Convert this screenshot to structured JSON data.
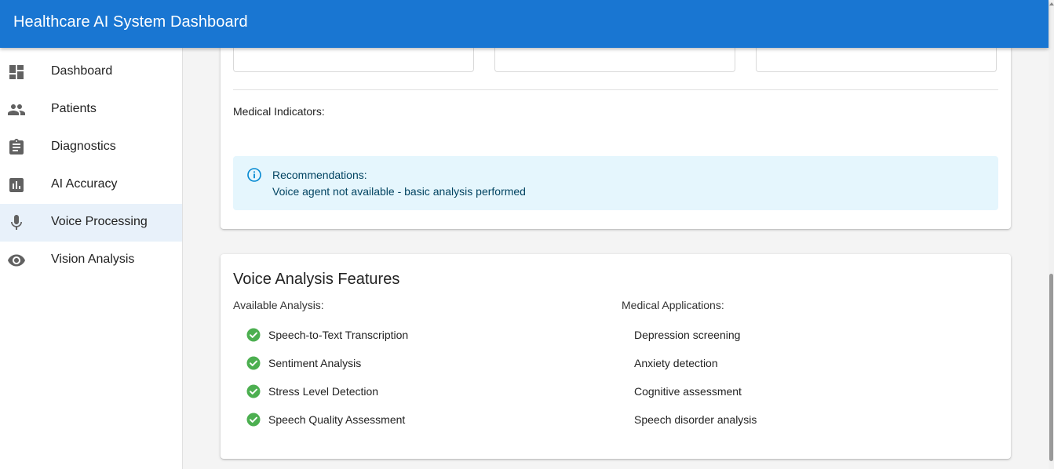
{
  "appbar": {
    "title": "Healthcare AI System Dashboard"
  },
  "sidebar": {
    "items": [
      {
        "label": "Dashboard",
        "icon": "dashboard-icon",
        "active": false
      },
      {
        "label": "Patients",
        "icon": "people-icon",
        "active": false
      },
      {
        "label": "Diagnostics",
        "icon": "clipboard-icon",
        "active": false
      },
      {
        "label": "AI Accuracy",
        "icon": "bar-chart-icon",
        "active": false
      },
      {
        "label": "Voice Processing",
        "icon": "microphone-icon",
        "active": true
      },
      {
        "label": "Vision Analysis",
        "icon": "eye-icon",
        "active": false
      }
    ]
  },
  "result_card": {
    "medical_indicators_label": "Medical Indicators:",
    "alert": {
      "icon": "info-icon",
      "title": "Recommendations:",
      "text": "Voice agent not available - basic analysis performed"
    }
  },
  "features_card": {
    "title": "Voice Analysis Features",
    "available_heading": "Available Analysis:",
    "available_items": [
      "Speech-to-Text Transcription",
      "Sentiment Analysis",
      "Stress Level Detection",
      "Speech Quality Assessment"
    ],
    "applications_heading": "Medical Applications:",
    "applications_items": [
      "Depression screening",
      "Anxiety detection",
      "Cognitive assessment",
      "Speech disorder analysis"
    ]
  },
  "colors": {
    "appbar": "#1976d2",
    "active_nav": "#e8f1fa",
    "alert_bg": "#e5f6fd",
    "alert_text": "#014361",
    "check": "#4caf50"
  }
}
